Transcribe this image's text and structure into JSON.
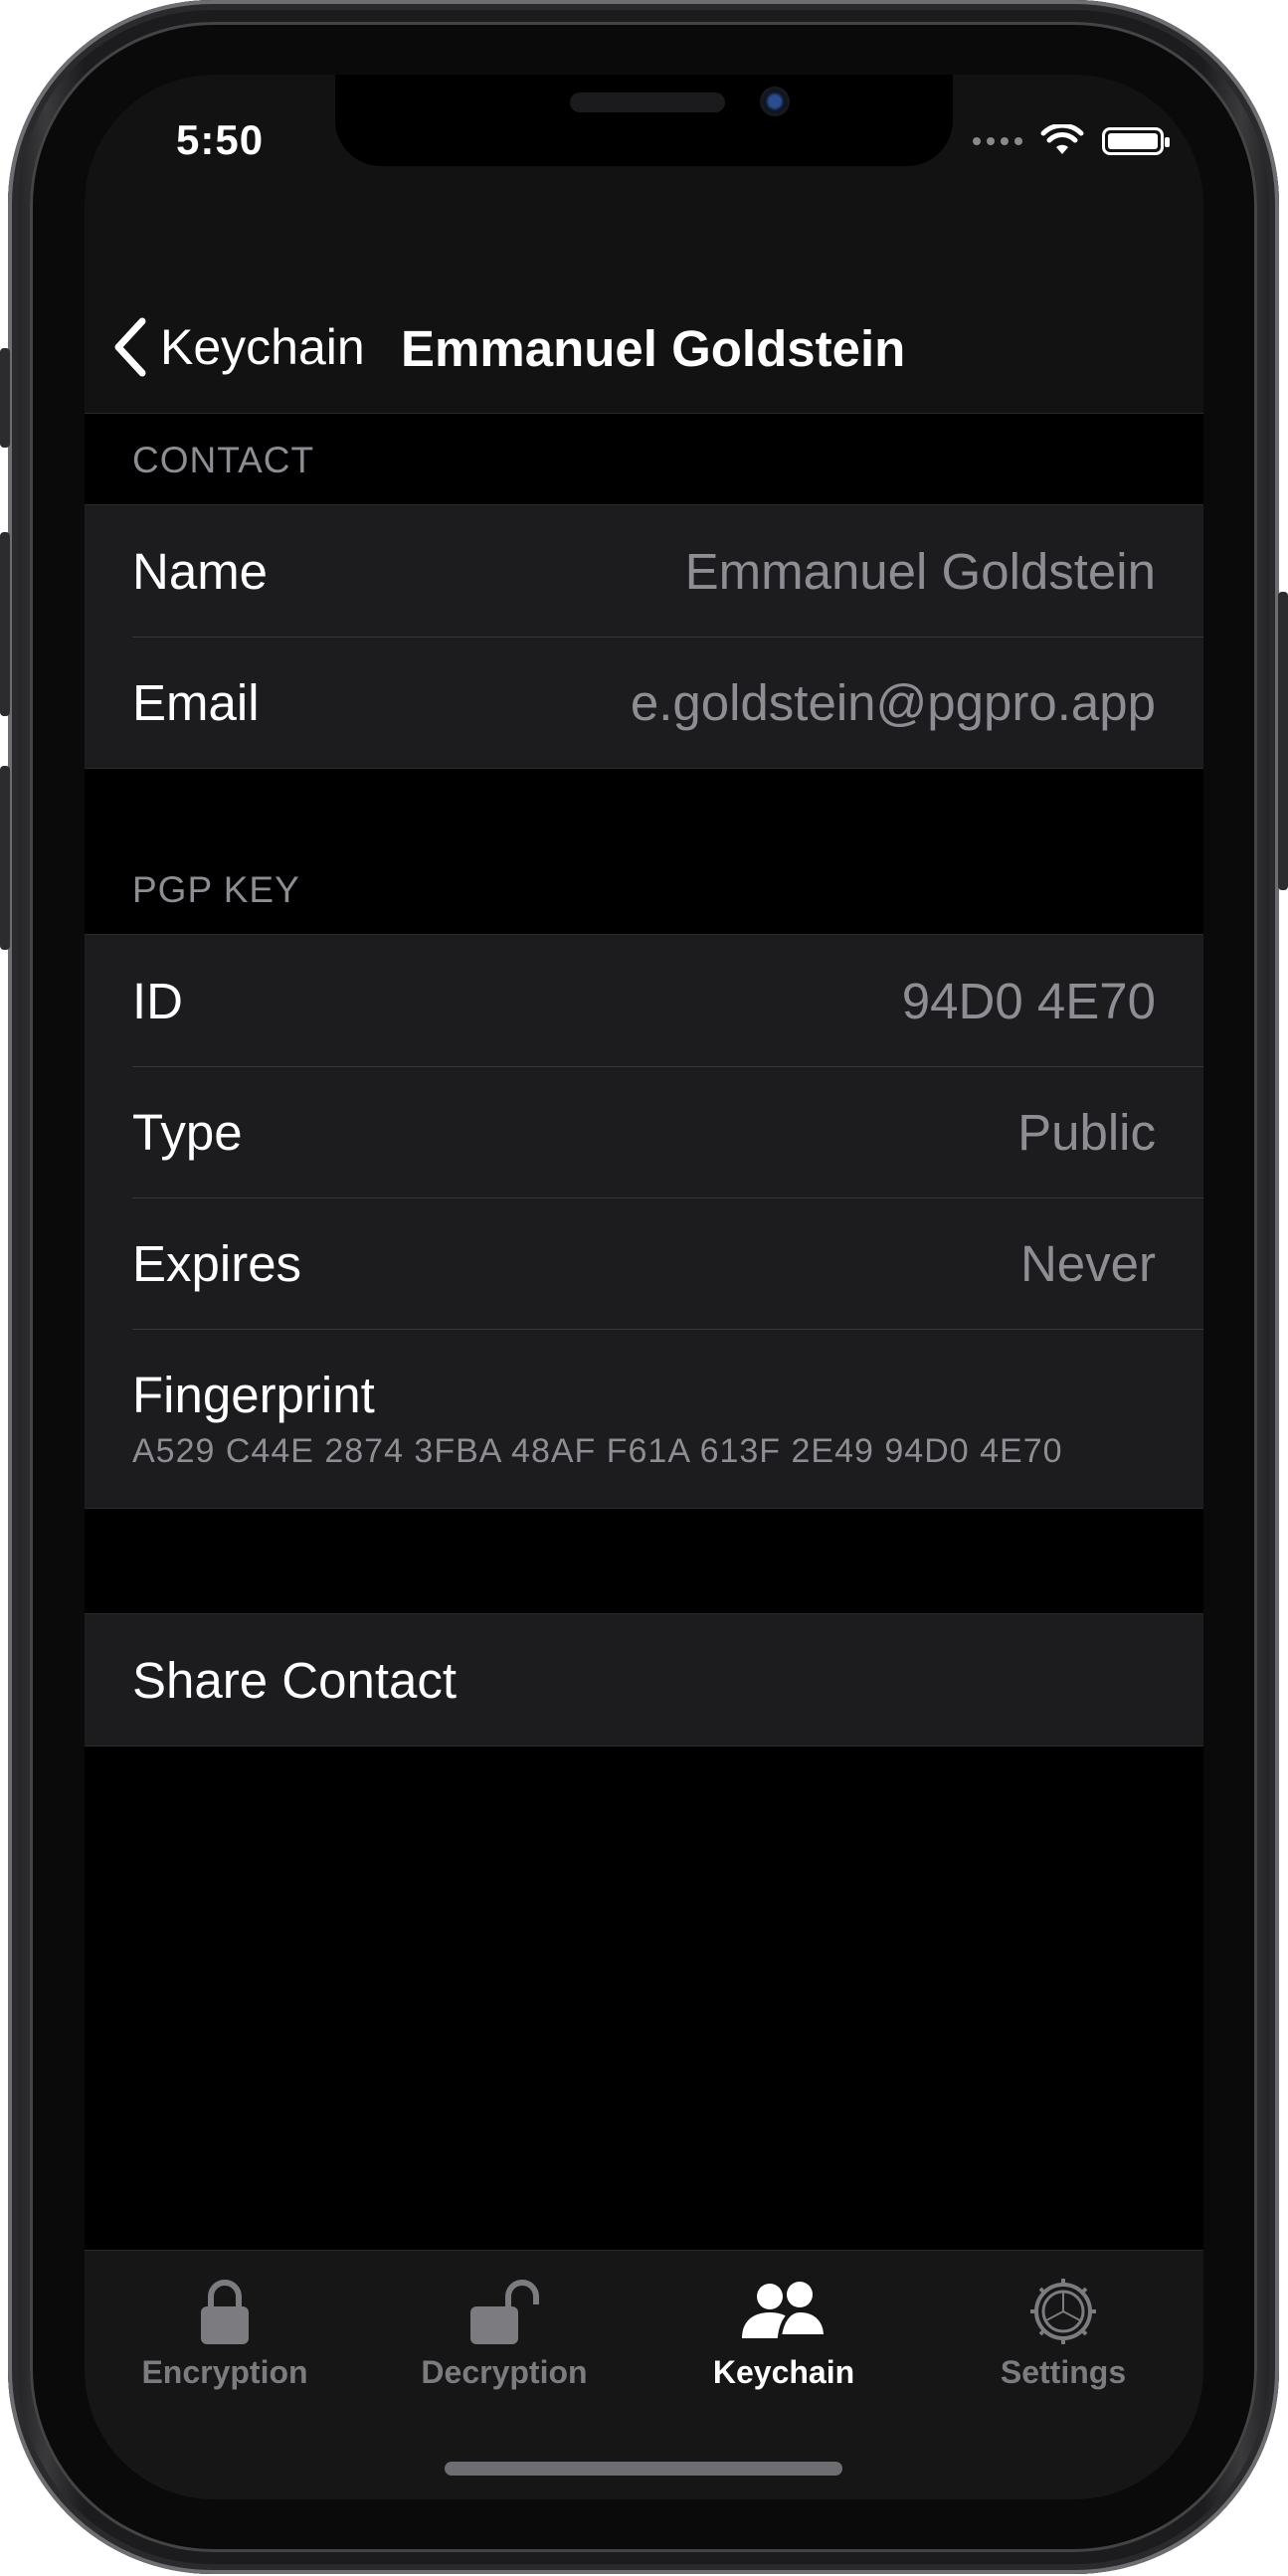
{
  "status_bar": {
    "time": "5:50"
  },
  "nav": {
    "back_label": "Keychain",
    "title": "Emmanuel Goldstein"
  },
  "contact": {
    "header": "CONTACT",
    "rows": [
      {
        "label": "Name",
        "value": "Emmanuel Goldstein"
      },
      {
        "label": "Email",
        "value": "e.goldstein@pgpro.app"
      }
    ]
  },
  "pgp_key": {
    "header": "PGP KEY",
    "rows": [
      {
        "label": "ID",
        "value": "94D0 4E70"
      },
      {
        "label": "Type",
        "value": "Public"
      },
      {
        "label": "Expires",
        "value": "Never"
      }
    ],
    "fingerprint_label": "Fingerprint",
    "fingerprint_value": "A529 C44E 2874 3FBA 48AF F61A 613F 2E49 94D0 4E70"
  },
  "actions": {
    "share_label": "Share Contact"
  },
  "tabs": [
    {
      "label": "Encryption",
      "icon": "lock-closed-icon",
      "active": false
    },
    {
      "label": "Decryption",
      "icon": "lock-open-icon",
      "active": false
    },
    {
      "label": "Keychain",
      "icon": "people-icon",
      "active": true
    },
    {
      "label": "Settings",
      "icon": "gear-icon",
      "active": false
    }
  ],
  "colors": {
    "background": "#000000",
    "cell": "#1c1c1e",
    "secondary_text": "#8d8d93",
    "inactive_tab": "#7b7b80"
  }
}
